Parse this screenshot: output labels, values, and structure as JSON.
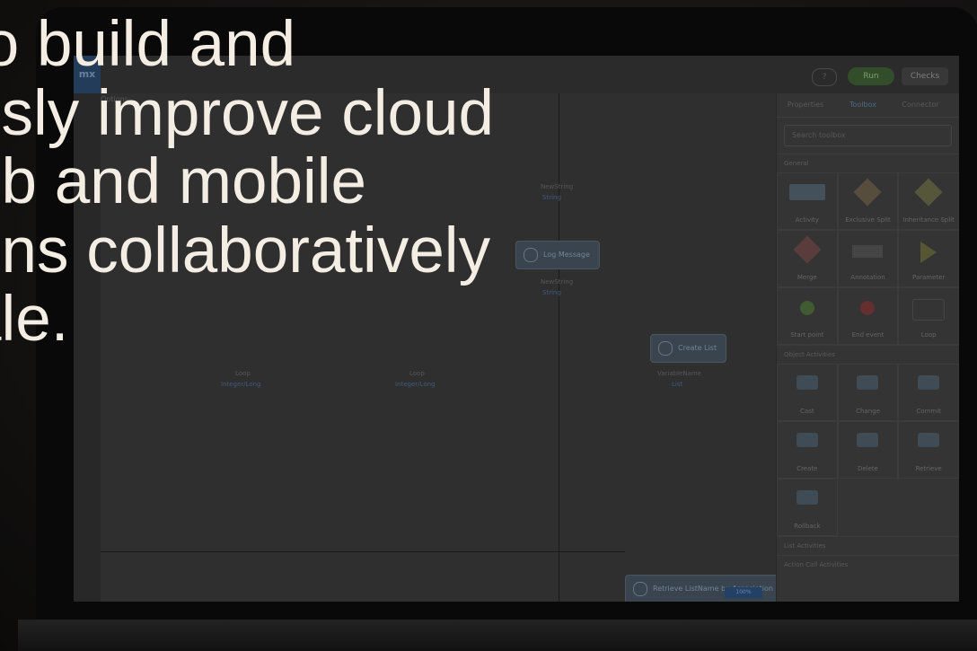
{
  "headline": {
    "lines": [
      "to build and",
      "usly improve cloud",
      "eb and mobile",
      "ons collaboratively",
      "ale."
    ]
  },
  "app": {
    "brand": "mx",
    "options_label": "Options",
    "help_label": "?",
    "run_label": "Run",
    "checks_label": "Checks",
    "zoom_label": "100%",
    "panel": {
      "tabs": [
        "Properties",
        "Toolbox",
        "Connector"
      ],
      "active_tab": "Toolbox",
      "search_placeholder": "Search toolbox",
      "sections": [
        "General",
        "Object Activities",
        "List Activities",
        "Action Call Activities"
      ],
      "general_tiles": [
        "Activity",
        "Exclusive Split",
        "Inheritance Split",
        "Merge",
        "Annotation",
        "Parameter",
        "Start point",
        "End event",
        "Loop"
      ],
      "object_tiles": [
        "Cast",
        "Change",
        "Commit",
        "Create",
        "Delete",
        "Retrieve",
        "Rollback"
      ]
    },
    "flow": {
      "node_log": "Log Message",
      "node_create_list": "Create List",
      "node_retrieve": "Retrieve ListName by Association",
      "sub_log": "NewString",
      "sub_log_type": "String",
      "sub_top": "NewString",
      "sub_top_type": "String",
      "sub_loop1": "Loop",
      "sub_loop1_type": "Integer/Long",
      "sub_loop2": "Loop",
      "sub_loop2_type": "Integer/Long",
      "sub_var": "VariableName",
      "sub_var_type": "List"
    }
  },
  "colors": {
    "headline": "#f4ede3",
    "run_button": "#3c5e33",
    "accent_blue": "#2b4f7e"
  }
}
